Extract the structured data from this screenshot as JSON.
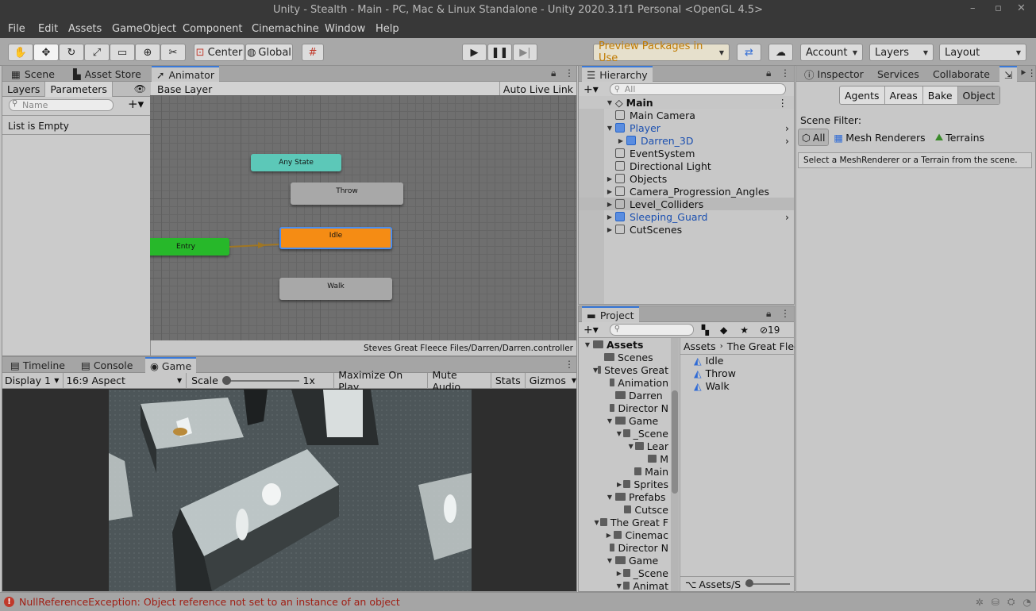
{
  "window": {
    "title": "Unity - Stealth - Main - PC, Mac & Linux Standalone - Unity 2020.3.1f1 Personal <OpenGL 4.5>"
  },
  "menu": [
    "File",
    "Edit",
    "Assets",
    "GameObject",
    "Component",
    "Cinemachine",
    "Window",
    "Help"
  ],
  "toolbar": {
    "pivot": "Center",
    "space": "Global",
    "preview_packages": "Preview Packages in Use",
    "account": "Account",
    "layers": "Layers",
    "layout": "Layout"
  },
  "left_tabs": [
    "Scene",
    "Asset Store",
    "Animator"
  ],
  "animator": {
    "sub_tabs": [
      "Layers",
      "Parameters"
    ],
    "search_placeholder": "Name",
    "empty_text": "List is Empty",
    "breadcrumb": "Base Layer",
    "auto_live_link": "Auto Live Link",
    "states": {
      "any_state": "Any State",
      "throw": "Throw",
      "idle": "Idle",
      "entry": "Entry",
      "walk": "Walk"
    },
    "footer_path": "Steves Great Fleece Files/Darren/Darren.controller",
    "colors": {
      "any_state": "#5cc8b8",
      "entry": "#27b82a",
      "idle": "#f58c14",
      "default": "#a8a8a8"
    }
  },
  "game": {
    "tabs": [
      "Timeline",
      "Console",
      "Game"
    ],
    "display": "Display 1",
    "aspect": "16:9 Aspect",
    "scale_label": "Scale",
    "scale_value": "1x",
    "toggles": [
      "Maximize On Play",
      "Mute Audio",
      "Stats",
      "Gizmos"
    ]
  },
  "hierarchy": {
    "tab": "Hierarchy",
    "search_placeholder": "All",
    "scene": "Main",
    "items": [
      {
        "label": "Main Camera",
        "blue": false,
        "arrow": false,
        "indent": 1
      },
      {
        "label": "Player",
        "blue": true,
        "arrow": true,
        "indent": 1,
        "open": true
      },
      {
        "label": "Darren_3D",
        "blue": true,
        "arrow": true,
        "indent": 2
      },
      {
        "label": "EventSystem",
        "blue": false,
        "arrow": false,
        "indent": 1
      },
      {
        "label": "Directional Light",
        "blue": false,
        "arrow": false,
        "indent": 1
      },
      {
        "label": "Objects",
        "blue": false,
        "arrow": true,
        "indent": 1
      },
      {
        "label": "Camera_Progression_Angles",
        "blue": false,
        "arrow": true,
        "indent": 1
      },
      {
        "label": "Level_Colliders",
        "blue": false,
        "arrow": true,
        "indent": 1,
        "selected": true
      },
      {
        "label": "Sleeping_Guard",
        "blue": true,
        "arrow": true,
        "indent": 1
      },
      {
        "label": "CutScenes",
        "blue": false,
        "arrow": true,
        "indent": 1
      }
    ]
  },
  "project": {
    "tab": "Project",
    "hidden_count": "19",
    "tree": [
      {
        "label": "Assets",
        "indent": 0,
        "arrow": "open",
        "bold": true
      },
      {
        "label": "Scenes",
        "indent": 1,
        "arrow": "none"
      },
      {
        "label": "Steves Great",
        "indent": 1,
        "arrow": "open"
      },
      {
        "label": "Animation",
        "indent": 2,
        "arrow": "none"
      },
      {
        "label": "Darren",
        "indent": 2,
        "arrow": "none"
      },
      {
        "label": "Director N",
        "indent": 2,
        "arrow": "none"
      },
      {
        "label": "Game",
        "indent": 2,
        "arrow": "open"
      },
      {
        "label": "_Scene",
        "indent": 3,
        "arrow": "open"
      },
      {
        "label": "Lear",
        "indent": 4,
        "arrow": "open"
      },
      {
        "label": "M",
        "indent": 5,
        "arrow": "none"
      },
      {
        "label": "Main",
        "indent": 4,
        "arrow": "none"
      },
      {
        "label": "Sprites",
        "indent": 3,
        "arrow": "closed"
      },
      {
        "label": "Prefabs",
        "indent": 2,
        "arrow": "open"
      },
      {
        "label": "Cutsce",
        "indent": 3,
        "arrow": "none"
      },
      {
        "label": "The Great F",
        "indent": 1,
        "arrow": "open"
      },
      {
        "label": "Cinemac",
        "indent": 2,
        "arrow": "closed"
      },
      {
        "label": "Director N",
        "indent": 2,
        "arrow": "none"
      },
      {
        "label": "Game",
        "indent": 2,
        "arrow": "open"
      },
      {
        "label": "_Scene",
        "indent": 3,
        "arrow": "closed"
      },
      {
        "label": "Animat",
        "indent": 3,
        "arrow": "open"
      }
    ],
    "breadcrumb": [
      "Assets",
      "The Great Flee"
    ],
    "files": [
      "Idle",
      "Throw",
      "Walk"
    ],
    "footer_path": "Assets/S"
  },
  "inspector": {
    "tabs": [
      "Inspector",
      "Services",
      "Collaborate"
    ],
    "nav_tabs": [
      "Agents",
      "Areas",
      "Bake",
      "Object"
    ],
    "scene_filter_label": "Scene Filter:",
    "filters": [
      "All",
      "Mesh Renderers",
      "Terrains"
    ],
    "hint": "Select a MeshRenderer or a Terrain from the scene."
  },
  "status": {
    "message": "NullReferenceException: Object reference not set to an instance of an object"
  }
}
